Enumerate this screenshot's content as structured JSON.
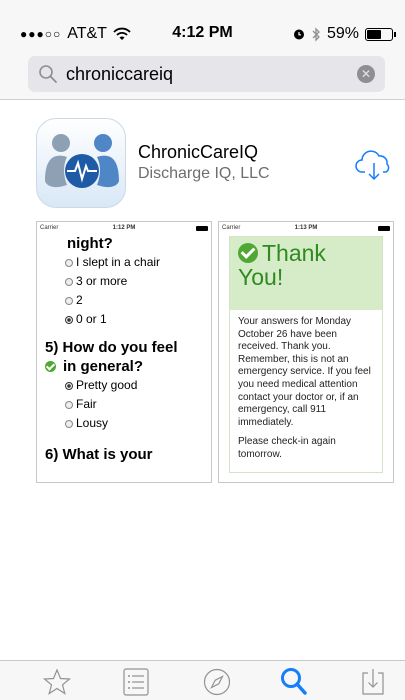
{
  "status_bar": {
    "carrier": "AT&T",
    "signal_dots": "●●●○○",
    "time": "4:12 PM",
    "battery": "59%",
    "battery_level": 0.59
  },
  "search": {
    "query": "chroniccareiq",
    "icon": "search-icon",
    "clear_icon": "clear-icon"
  },
  "app": {
    "name": "ChronicCareIQ",
    "developer": "Discharge IQ, LLC",
    "download_icon": "cloud-download-icon"
  },
  "screenshots": [
    {
      "status": {
        "carrier": "Carrier",
        "time": "1:12 PM"
      },
      "question_tail": "night?",
      "options": [
        {
          "label": "I slept in a chair",
          "selected": false
        },
        {
          "label": "3 or more",
          "selected": false
        },
        {
          "label": "2",
          "selected": false
        },
        {
          "label": "0 or 1",
          "selected": true
        }
      ],
      "q5_line1": "5) How do you feel",
      "q5_line2": "in general?",
      "q5_options": [
        {
          "label": "Pretty good",
          "selected": true
        },
        {
          "label": "Fair",
          "selected": false
        },
        {
          "label": "Lousy",
          "selected": false
        }
      ],
      "q6_partial": "6) What is your"
    },
    {
      "status": {
        "carrier": "Carrier",
        "time": "1:13 PM"
      },
      "thank_line1": "Thank",
      "thank_line2": "You!",
      "message": "Your answers for Monday October 26 have been received. Thank you. Remember, this is not an emergency service. If you feel you need medical attention contact your doctor or, if an emergency, call 911 immediately.",
      "footer": "Please check-in again tomorrow."
    }
  ],
  "tab_bar": {
    "tabs": [
      {
        "name": "featured",
        "icon": "star-icon",
        "active": false
      },
      {
        "name": "top-charts",
        "icon": "list-icon",
        "active": false
      },
      {
        "name": "explore",
        "icon": "compass-icon",
        "active": false
      },
      {
        "name": "search",
        "icon": "search-icon",
        "active": true
      },
      {
        "name": "updates",
        "icon": "download-tray-icon",
        "active": false
      }
    ],
    "active_color": "#147efb",
    "inactive_color": "#929292"
  }
}
